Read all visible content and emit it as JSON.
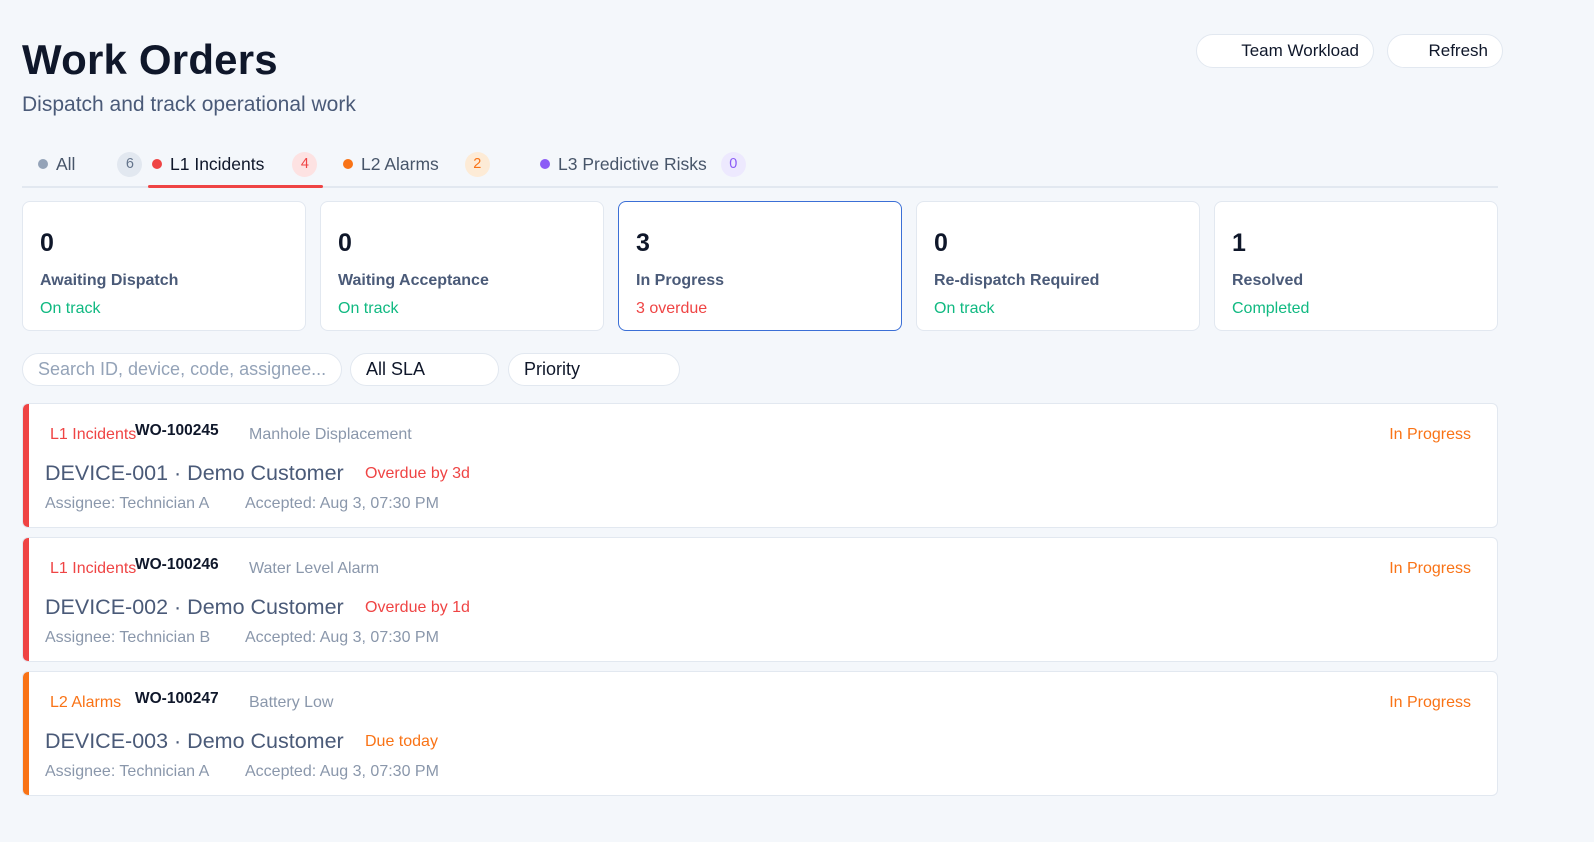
{
  "header": {
    "title": "Work Orders",
    "subtitle": "Dispatch and track operational work",
    "team_workload_label": "Team Workload",
    "refresh_label": "Refresh"
  },
  "tabs": [
    {
      "label": "All",
      "count": "6",
      "dot_color": "#94a3b8"
    },
    {
      "label": "L1 Incidents",
      "count": "4",
      "dot_color": "#ef4444",
      "active": true
    },
    {
      "label": "L2 Alarms",
      "count": "2",
      "dot_color": "#f97316"
    },
    {
      "label": "L3 Predictive Risks",
      "count": "0",
      "dot_color": "#8b5cf6"
    }
  ],
  "stats": [
    {
      "value": "0",
      "label": "Awaiting Dispatch",
      "status": "On track",
      "status_color": "#10b981"
    },
    {
      "value": "0",
      "label": "Waiting Acceptance",
      "status": "On track",
      "status_color": "#10b981"
    },
    {
      "value": "3",
      "label": "In Progress",
      "status": "3 overdue",
      "status_color": "#ef4444",
      "selected": true
    },
    {
      "value": "0",
      "label": "Re-dispatch Required",
      "status": "On track",
      "status_color": "#10b981"
    },
    {
      "value": "1",
      "label": "Resolved",
      "status": "Completed",
      "status_color": "#10b981"
    }
  ],
  "filters": {
    "search_placeholder": "Search ID, device, code, assignee...",
    "sla_value": "All SLA",
    "priority_value": "Priority"
  },
  "work_orders": [
    {
      "level": "L1 Incidents",
      "id": "WO-100245",
      "type": "Manhole Displacement",
      "status": "In Progress",
      "device": "DEVICE-001 · Demo Customer",
      "due": "Overdue by 3d",
      "assignee": "Assignee: Technician A",
      "accepted": "Accepted: Aug 3, 07:30 PM",
      "accent_color": "#ef4444"
    },
    {
      "level": "L1 Incidents",
      "id": "WO-100246",
      "type": "Water Level Alarm",
      "status": "In Progress",
      "device": "DEVICE-002 · Demo Customer",
      "due": "Overdue by 1d",
      "assignee": "Assignee: Technician B",
      "accepted": "Accepted: Aug 3, 07:30 PM",
      "accent_color": "#ef4444"
    },
    {
      "level": "L2 Alarms",
      "id": "WO-100247",
      "type": "Battery Low",
      "status": "In Progress",
      "device": "DEVICE-003 · Demo Customer",
      "due": "Due today",
      "assignee": "Assignee: Technician A",
      "accepted": "Accepted: Aug 3, 07:30 PM",
      "accent_color": "#f97316"
    }
  ]
}
